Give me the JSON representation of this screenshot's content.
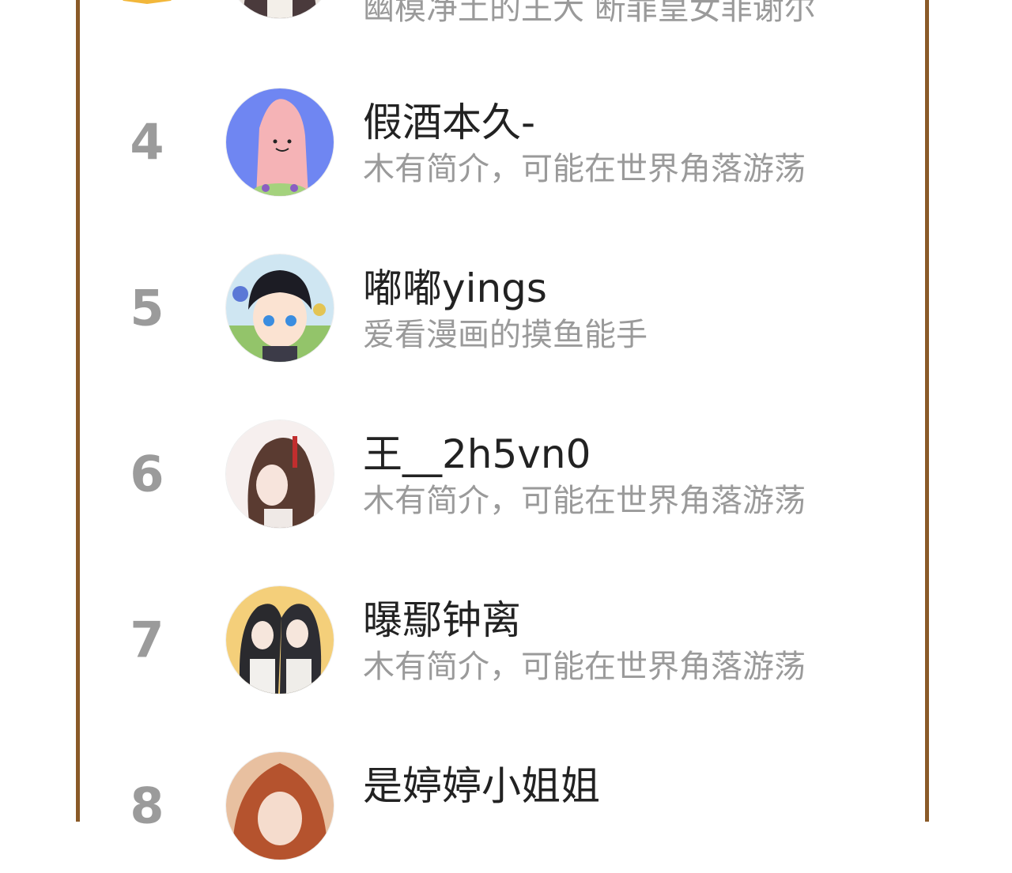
{
  "ranking": {
    "rows": [
      {
        "rank": "",
        "name": "",
        "bio": "幽模净土的王大 断罪皇女菲谢尔",
        "avatar_icon": "avatar-dark-hair-girl-icon"
      },
      {
        "rank": "4",
        "name": "假酒本久-",
        "bio": "木有简介，可能在世界角落游荡",
        "avatar_icon": "avatar-patrick-star-icon"
      },
      {
        "rank": "5",
        "name": "嘟嘟yings",
        "bio": "爱看漫画的摸鱼能手",
        "avatar_icon": "avatar-boy-blue-eyes-icon"
      },
      {
        "rank": "6",
        "name": "王__2h5vn0",
        "bio": "木有简介，可能在世界角落游荡",
        "avatar_icon": "avatar-long-hair-man-icon"
      },
      {
        "rank": "7",
        "name": "曝鄢钟离",
        "bio": "木有简介，可能在世界角落游荡",
        "avatar_icon": "avatar-two-characters-icon"
      },
      {
        "rank": "8",
        "name": "是婷婷小姐姐",
        "bio": "",
        "avatar_icon": "avatar-red-hair-girl-icon"
      }
    ]
  },
  "colors": {
    "frame_border": "#8a5a28",
    "rank_text": "#9b9b9b",
    "name_text": "#222222",
    "bio_text": "#9a9a9a",
    "crown": "#f2b73a"
  }
}
